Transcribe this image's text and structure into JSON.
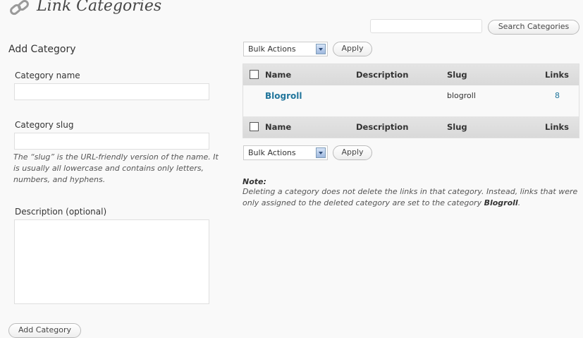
{
  "header": {
    "title": "Link Categories",
    "icon": "link-icon"
  },
  "search": {
    "placeholder": "",
    "button_label": "Search Categories"
  },
  "add_form": {
    "heading": "Add Category",
    "name_label": "Category name",
    "name_value": "",
    "slug_label": "Category slug",
    "slug_value": "",
    "slug_help": "The “slug” is the URL-friendly version of the name. It is usually all lowercase and contains only letters, numbers, and hyphens.",
    "description_label": "Description (optional)",
    "description_value": "",
    "submit_label": "Add Category"
  },
  "bulk_top": {
    "selected": "Bulk Actions",
    "apply_label": "Apply"
  },
  "bulk_bottom": {
    "selected": "Bulk Actions",
    "apply_label": "Apply"
  },
  "table": {
    "columns": [
      "Name",
      "Description",
      "Slug",
      "Links"
    ],
    "rows": [
      {
        "name": "Blogroll",
        "description": "",
        "slug": "blogroll",
        "links": "8"
      }
    ]
  },
  "note": {
    "heading": "Note:",
    "text_before": "Deleting a category does not delete the links in that category. Instead, links that were only assigned to the deleted category are set to the category ",
    "category": "Blogroll",
    "text_after": "."
  },
  "colors": {
    "link": "#21759b",
    "header_bg": "#dfdfdf",
    "page_bg": "#f9f9f9"
  }
}
